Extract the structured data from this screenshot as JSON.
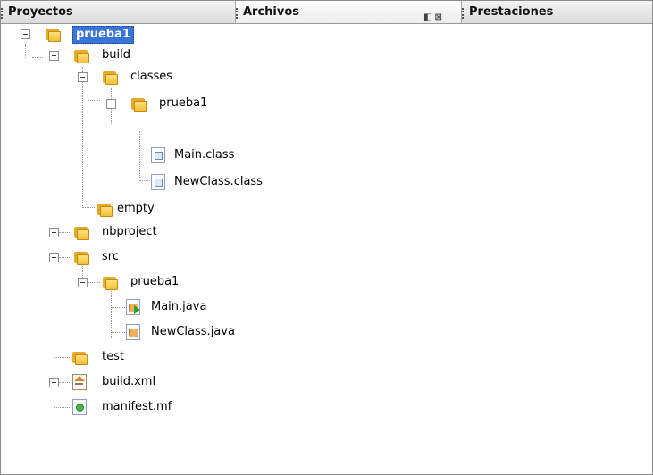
{
  "tabs": [
    {
      "label": "Proyectos"
    },
    {
      "label": "Archivos",
      "controls": [
        "◧",
        "⊠"
      ]
    },
    {
      "label": "Prestaciones"
    }
  ],
  "tree": [
    {
      "label": "prueba1",
      "icon": "folder-icon",
      "selected": true
    },
    {
      "label": "build",
      "icon": "folder-icon"
    },
    {
      "label": "classes",
      "icon": "folder-icon"
    },
    {
      "label": "prueba1",
      "icon": "folder-icon"
    },
    {
      "label": "Main.class",
      "icon": "class-file-icon"
    },
    {
      "label": "NewClass.class",
      "icon": "class-file-icon"
    },
    {
      "label": "empty",
      "icon": "folder-icon"
    },
    {
      "label": "nbproject",
      "icon": "folder-icon"
    },
    {
      "label": "src",
      "icon": "folder-icon"
    },
    {
      "label": "prueba1",
      "icon": "folder-icon"
    },
    {
      "label": "Main.java",
      "icon": "java-main-file-icon"
    },
    {
      "label": "NewClass.java",
      "icon": "java-file-icon"
    },
    {
      "label": "test",
      "icon": "folder-icon"
    },
    {
      "label": "build.xml",
      "icon": "xml-file-icon"
    },
    {
      "label": "manifest.mf",
      "icon": "manifest-file-icon"
    }
  ],
  "colors": {
    "selection": "#3875d7",
    "folder": "#f3bf3a"
  }
}
